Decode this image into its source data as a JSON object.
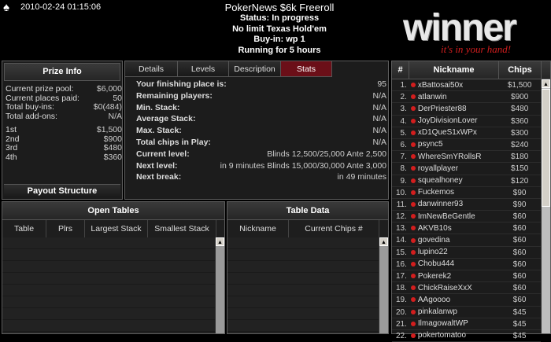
{
  "header": {
    "datetime": "2010-02-24 01:15:06",
    "title": "PokerNews $6k Freeroll",
    "status": "Status: In progress",
    "game": "No limit Texas Hold'em",
    "buyin": "Buy-in: wp 1",
    "running": "Running for 5 hours",
    "logo_text": "winner",
    "logo_tagline": "it's in your hand!"
  },
  "prize_info": {
    "title": "Prize Info",
    "rows": [
      {
        "k": "Current prize pool:",
        "v": "$6,000"
      },
      {
        "k": "Current places paid:",
        "v": "50"
      },
      {
        "k": "Total buy-ins:",
        "v": "$0(484)"
      },
      {
        "k": "Total add-ons:",
        "v": "N/A"
      }
    ],
    "places": [
      {
        "k": "1st",
        "v": "$1,500"
      },
      {
        "k": "2nd",
        "v": "$900"
      },
      {
        "k": "3rd",
        "v": "$480"
      },
      {
        "k": "4th",
        "v": "$360"
      }
    ],
    "payout_button": "Payout Structure"
  },
  "stats_panel": {
    "tabs": [
      "Details",
      "Levels",
      "Description",
      "Stats"
    ],
    "active_tab": "Stats",
    "rows": [
      {
        "k": "Your finishing place is:",
        "v": "95"
      },
      {
        "k": "Remaining players:",
        "v": "N/A"
      },
      {
        "k": "Min. Stack:",
        "v": "N/A"
      },
      {
        "k": "Average Stack:",
        "v": "N/A"
      },
      {
        "k": "Max. Stack:",
        "v": "N/A"
      },
      {
        "k": "Total chips in Play:",
        "v": "N/A"
      },
      {
        "k": "Current level:",
        "v": "Blinds 12,500/25,000 Ante 2,500"
      },
      {
        "k": "Next level:",
        "v": "in 9 minutes Blinds 15,000/30,000 Ante 3,000"
      },
      {
        "k": "Next break:",
        "v": "in 49 minutes"
      }
    ]
  },
  "open_tables": {
    "title": "Open Tables",
    "columns": [
      "Table",
      "Plrs",
      "Largest Stack",
      "Smallest Stack"
    ]
  },
  "table_data": {
    "title": "Table Data",
    "columns": [
      "Nickname",
      "Current Chips #"
    ]
  },
  "players": {
    "columns": [
      "#",
      "Nickname",
      "Chips"
    ],
    "rows": [
      {
        "n": "1.",
        "nick": "xBattosai50x",
        "chips": "$1,500"
      },
      {
        "n": "2.",
        "nick": "atlanwin",
        "chips": "$900"
      },
      {
        "n": "3.",
        "nick": "DerPriester88",
        "chips": "$480"
      },
      {
        "n": "4.",
        "nick": "JoyDivisionLover",
        "chips": "$360"
      },
      {
        "n": "5.",
        "nick": "xD1QueS1xWPx",
        "chips": "$300"
      },
      {
        "n": "6.",
        "nick": "psync5",
        "chips": "$240"
      },
      {
        "n": "7.",
        "nick": "WhereSmYRollsR",
        "chips": "$180"
      },
      {
        "n": "8.",
        "nick": "royallplayer",
        "chips": "$150"
      },
      {
        "n": "9.",
        "nick": "squealhoney",
        "chips": "$120"
      },
      {
        "n": "10.",
        "nick": "Fuckemos",
        "chips": "$90"
      },
      {
        "n": "11.",
        "nick": "danwinner93",
        "chips": "$90"
      },
      {
        "n": "12.",
        "nick": "ImNewBeGentle",
        "chips": "$60"
      },
      {
        "n": "13.",
        "nick": "AKVB10s",
        "chips": "$60"
      },
      {
        "n": "14.",
        "nick": "govedina",
        "chips": "$60"
      },
      {
        "n": "15.",
        "nick": "lupino22",
        "chips": "$60"
      },
      {
        "n": "16.",
        "nick": "Chobu444",
        "chips": "$60"
      },
      {
        "n": "17.",
        "nick": "Pokerek2",
        "chips": "$60"
      },
      {
        "n": "18.",
        "nick": "ChickRaiseXxX",
        "chips": "$60"
      },
      {
        "n": "19.",
        "nick": "AAgoooo",
        "chips": "$60"
      },
      {
        "n": "20.",
        "nick": "pinkalanwp",
        "chips": "$45"
      },
      {
        "n": "21.",
        "nick": "IlmagowaltWP",
        "chips": "$45"
      },
      {
        "n": "22.",
        "nick": "pokertomatoo",
        "chips": "$45"
      }
    ]
  }
}
